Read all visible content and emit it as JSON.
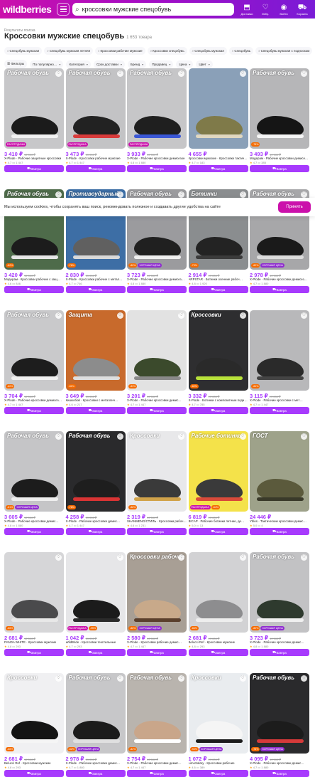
{
  "header": {
    "logo": "wildberries",
    "search_value": "кроссовки мужские спецобувь",
    "actions": [
      {
        "icon": "package-icon",
        "label": "Доставки"
      },
      {
        "icon": "heart-icon",
        "label": "Избр."
      },
      {
        "icon": "user-icon",
        "label": "Войти"
      },
      {
        "icon": "cart-icon",
        "label": "Корзина"
      }
    ]
  },
  "results": {
    "breadcrumb": "Результаты поиска",
    "title": "Кроссовки мужские спецобувь",
    "count": "1 653 товара"
  },
  "tags": [
    "Спецобувь мужская",
    "Спецобувь мужская летняя",
    "Кроссовки рабочие мужские",
    "Кроссовки спецобувь",
    "Спецобувь мужская",
    "Спецобувь",
    "Спецобувь мужская с подноском"
  ],
  "filters": [
    "Фильтры",
    "По популярно…",
    "Категория",
    "Срок доставки",
    "Бренд",
    "Продавец",
    "Цена",
    "Цвет"
  ],
  "cookie": {
    "text": "Мы используем cookies, чтобы сохранять ваш поиск, рекомендовать полезное и создавать другие удобства на сайте",
    "button": "Принять"
  },
  "colors": {
    "brand_gradient_start": "#cb11ab",
    "brand_gradient_end": "#7a1bd6",
    "price": "#a73afd",
    "button": "#a73afd"
  },
  "buy_label": "Завтра",
  "products": [
    {
      "price": "3 410 ₽",
      "old": "19 000 ₽",
      "name": "X-Plode · Рабочие защитные кроссовки",
      "rating": "4.7",
      "reviews": "1 447",
      "banner": "Рабочая обувь",
      "bg": "#c7c7c9",
      "shoe": "#1b1b1b",
      "sole": "#f2f2f2",
      "badges": [
        "РАСПРОДАЖА"
      ]
    },
    {
      "price": "3 473 ₽",
      "old": "19 000 ₽",
      "name": "X-Plode · Кроссовки рабочие мужские",
      "rating": "4.7",
      "reviews": "1 447",
      "banner": "Рабочая обувь",
      "bg": "#c3c3c5",
      "shoe": "#222222",
      "sole": "#d93b3b",
      "badges": [
        "РАСПРОДАЖА"
      ]
    },
    {
      "price": "3 933 ₽",
      "old": "19 000 ₽",
      "name": "X-Plode · Рабочие кроссовки демисезон",
      "rating": "4.8",
      "reviews": "1 880",
      "banner": "Рабочая обувь",
      "bg": "#c6c6c8",
      "shoe": "#1f1f1f",
      "sole": "#3a57d6",
      "badges": [
        "РАСПРОДАЖА"
      ]
    },
    {
      "price": "4 655 ₽",
      "old": "",
      "name": "Кроссовки мужские · Кроссовки тактические",
      "rating": "4.7",
      "reviews": "183",
      "banner": "",
      "bg": "#8aa0b8",
      "shoe": "#7f7a49",
      "sole": "#e0d7c0",
      "badges": []
    },
    {
      "price": "3 493 ₽",
      "old": "19 000 ₽",
      "name": "Модерам · Рабочие кроссовки демисезон",
      "rating": "4.7",
      "reviews": "385",
      "banner": "Рабочая обувь",
      "bg": "#b6b6b8",
      "shoe": "#151515",
      "sole": "#f5f5f5",
      "badges": [
        "-78%"
      ]
    },
    {
      "price": "3 420 ₽",
      "old": "19 000 ₽",
      "name": "Модерам · Кроссовки рабочие с защ…",
      "rating": "4.6",
      "reviews": "846",
      "banner": "Рабочая обувь",
      "bg": "#4e6b4a",
      "shoe": "#1c1c1c",
      "sole": "#e6e6e6",
      "badges": [
        "-82%"
      ]
    },
    {
      "price": "2 830 ₽",
      "old": "19 000 ₽",
      "name": "X-Plode · Кроссовки рабочие с метал…",
      "rating": "4.7",
      "reviews": "746",
      "banner": "Противоударный",
      "bg": "#3d6ea5",
      "shoe": "#606060",
      "sole": "#d8d8d8",
      "badges": [
        "-78%"
      ]
    },
    {
      "price": "3 723 ₽",
      "old": "19 000 ₽",
      "name": "X-Plode · Рабочие кроссовки демисез…",
      "rating": "4.8",
      "reviews": "1 880",
      "banner": "Рабочая обувь",
      "bg": "#9b9b9e",
      "shoe": "#202020",
      "sole": "#efefef",
      "badges": [
        "-80%",
        "ХОРОШАЯ ЦЕНА"
      ]
    },
    {
      "price": "2 914 ₽",
      "old": "19 000 ₽",
      "name": "ARPSTAR · Ботинки осенние рабоч…",
      "rating": "4.8",
      "reviews": "1 920",
      "banner": "Ботинки",
      "bg": "#8a8d8f",
      "shoe": "#232323",
      "sole": "#3b3b3b",
      "badges": [
        "-79%"
      ]
    },
    {
      "price": "2 978 ₽",
      "old": "19 000 ₽",
      "name": "X-Plode · Рабочие кроссовки демисез…",
      "rating": "4.7",
      "reviews": "1 880",
      "banner": "Рабочая обувь",
      "bg": "#a7a7a9",
      "shoe": "#1a1a1a",
      "sole": "#dcdcdc",
      "badges": [
        "-82%",
        "ХОРОШАЯ ЦЕНА"
      ]
    },
    {
      "price": "3 704 ₽",
      "old": "19 000 ₽",
      "name": "X-Plode · Рабочие кроссовки демисез…",
      "rating": "4.7",
      "reviews": "1 447",
      "banner": "Рабочая обувь",
      "bg": "#c9c9cb",
      "shoe": "#1d1d1d",
      "sole": "#f0f0f0",
      "badges": [
        "-80%"
      ]
    },
    {
      "price": "3 649 ₽",
      "old": "19 000 ₽",
      "name": "Кишкобой · Кроссовки с металлич…",
      "rating": "4.6",
      "reviews": "217",
      "banner": "Защита",
      "bg": "#c86a2c",
      "shoe": "#8c8c8c",
      "sole": "#dedede",
      "badges": [
        "-81%"
      ]
    },
    {
      "price": "3 201 ₽",
      "old": "19 000 ₽",
      "name": "X-Plode · Рабочие кроссовки демис…",
      "rating": "4.7",
      "reviews": "1 447",
      "banner": "",
      "bg": "#e2e2e2",
      "shoe": "#3b4a2c",
      "sole": "#8a8a8a",
      "badges": [
        "-83%"
      ]
    },
    {
      "price": "3 332 ₽",
      "old": "19 000 ₽",
      "name": "X-Plode · Ботинки с композитным подноском",
      "rating": "4.7",
      "reviews": "785",
      "banner": "Кроссовки",
      "bg": "#2e2e30",
      "shoe": "#2a2a2a",
      "sole": "#b8e23a",
      "badges": [
        "-82%"
      ]
    },
    {
      "price": "3 115 ₽",
      "old": "19 000 ₽",
      "name": "X-Plode · Рабочие кроссовки с мет…",
      "rating": "4.7",
      "reviews": "1 447",
      "banner": "",
      "bg": "#b8b8ba",
      "shoe": "#2a2a2a",
      "sole": "#444444",
      "badges": [
        "-84%"
      ]
    },
    {
      "price": "3 605 ₽",
      "old": "19 000 ₽",
      "name": "X-Plode · Рабочие кроссовки демис…",
      "rating": "4.8",
      "reviews": "1 880",
      "banner": "Рабочая обувь",
      "bg": "#c5c5c7",
      "shoe": "#1c1c1c",
      "sole": "#eeeeee",
      "badges": [
        "-81%",
        "ХОРОШАЯ ЦЕНА"
      ]
    },
    {
      "price": "4 258 ₽",
      "old": "19 000 ₽",
      "name": "X-Plode · Рабочие кроссовки демис…",
      "rating": "4.7",
      "reviews": "1 447",
      "banner": "Рабочая обувь",
      "bg": "#2a2a2c",
      "shoe": "#1e1e1e",
      "sole": "#d93434",
      "badges": [
        "-78%"
      ]
    },
    {
      "price": "2 319 ₽",
      "old": "19 000 ₽",
      "name": "SHANMENG/СТИЛЬ · Кроссовки рабочие",
      "rating": "4.6",
      "reviews": "1 231",
      "banner": "Кроссовки",
      "bg": "#e8e8ea",
      "shoe": "#3a3a3a",
      "sole": "#d1a34a",
      "badges": [
        "-88%"
      ]
    },
    {
      "price": "6 819 ₽",
      "old": "19 000 ₽",
      "name": "BICAP · Рабочие ботинки летние, де…",
      "rating": "5.0",
      "reviews": "13",
      "banner": "Рабочие ботинки",
      "bg": "#f4e24a",
      "shoe": "#3a3a3a",
      "sole": "#d94a3a",
      "badges": [
        "РАСПРОДАЖА",
        "-64%"
      ]
    },
    {
      "price": "24 446 ₽",
      "old": "",
      "name": "Ybles · Тактические кроссовки демис…",
      "rating": "5.0",
      "reviews": "4",
      "banner": "ГОСТ",
      "bg": "#9ea28a",
      "shoe": "#5b5a3c",
      "sole": "#3a3a2a",
      "badges": []
    },
    {
      "price": "2 681 ₽",
      "old": "19 000 ₽",
      "name": "PANDA WHITE · Кроссовки мужские",
      "rating": "4.8",
      "reviews": "293",
      "banner": "",
      "bg": "#d6d6d8",
      "shoe": "#4a4a4c",
      "sole": "#e8e8e8",
      "badges": [
        "-86%"
      ]
    },
    {
      "price": "1 042 ₽",
      "old": "19 000 ₽",
      "name": "WildBride · Кроссовки текстильные",
      "rating": "4.7",
      "reviews": "293",
      "banner": "",
      "bg": "#e6e6e8",
      "shoe": "#1b1b1b",
      "sole": "#2b2b2b",
      "badges": [
        "РАСПРОДАЖА",
        "-95%"
      ]
    },
    {
      "price": "2 580 ₽",
      "old": "19 000 ₽",
      "name": "X-Plode · Кроссовки рабочие демис…",
      "rating": "4.7",
      "reviews": "1 447",
      "banner": "Кроссовки рабочие",
      "bg": "#a89f95",
      "shoe": "#c8a98a",
      "sole": "#5a3f2c",
      "badges": [
        "-86%",
        "ХОРОШАЯ ЦЕНА"
      ]
    },
    {
      "price": "2 681 ₽",
      "old": "19 000 ₽",
      "name": "Belucci Ref · Кроссовки мужские",
      "rating": "4.8",
      "reviews": "293",
      "banner": "",
      "bg": "#d2d2d4",
      "shoe": "#8d8d8f",
      "sole": "#eeeeee",
      "badges": [
        "-86%"
      ]
    },
    {
      "price": "3 723 ₽",
      "old": "19 000 ₽",
      "name": "X-Plode · Рабочие кроссовки демис…",
      "rating": "4.8",
      "reviews": "1 880",
      "banner": "Рабочая обувь",
      "bg": "#c2c2c4",
      "shoe": "#2e3a2e",
      "sole": "#f0f0f0",
      "badges": [
        "-80%",
        "ХОРОШАЯ ЦЕНА"
      ]
    },
    {
      "price": "2 681 ₽",
      "old": "19 000 ₽",
      "name": "Belucci Ref · Кроссовки мужские",
      "rating": "4.8",
      "reviews": "293",
      "banner": "Кроссовки",
      "bg": "#f0f0f2",
      "shoe": "#141414",
      "sole": "#f5f5f5",
      "badges": [
        "-86%"
      ]
    },
    {
      "price": "2 978 ₽",
      "old": "19 000 ₽",
      "name": "X-Plode · Рабочие кроссовки демис…",
      "rating": "4.7",
      "reviews": "1 880",
      "banner": "Рабочая обувь",
      "bg": "#c7c7c9",
      "shoe": "#1b1b1b",
      "sole": "#e0e0e0",
      "badges": [
        "-82%",
        "ХОРОШАЯ ЦЕНА"
      ]
    },
    {
      "price": "2 754 ₽",
      "old": "19 000 ₽",
      "name": "X-Plode · Рабочие кроссовки демис…",
      "rating": "4.7",
      "reviews": "1 447",
      "banner": "Рабочая обувь",
      "bg": "#b9b4ae",
      "shoe": "#c9a68a",
      "sole": "#ffffff",
      "badges": [
        "-82%"
      ]
    },
    {
      "price": "1 072 ₽",
      "old": "19 000 ₽",
      "name": "LimeSalary · Кроссовки рабочие",
      "rating": "4.6",
      "reviews": "389",
      "banner": "Кроссовки",
      "bg": "#e9ecef",
      "shoe": "#f5f5f5",
      "sole": "#1b1b1b",
      "badges": [
        "-94%",
        "ХОРОШАЯ ЦЕНА"
      ]
    },
    {
      "price": "4 095 ₽",
      "old": "19 000 ₽",
      "name": "X-Plode · Рабочие кроссовки демис…",
      "rating": "4.7",
      "reviews": "1 880",
      "banner": "Рабочая обувь",
      "bg": "#2a2a2c",
      "shoe": "#1c1c1c",
      "sole": "#d63a3a",
      "badges": [
        "-78%",
        "ХОРОШАЯ ЦЕНА"
      ]
    }
  ]
}
